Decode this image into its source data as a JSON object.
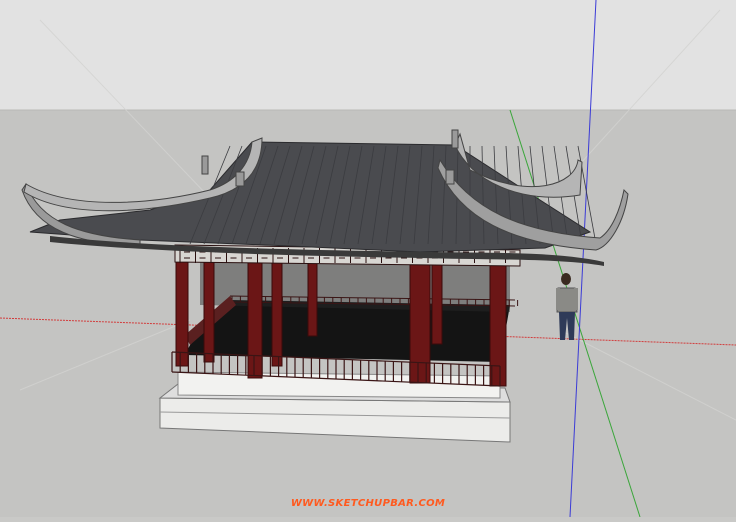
{
  "app": {
    "name": "SketchUp"
  },
  "scene": {
    "subject": "pavilion-model",
    "sky_color": "#e2e2e2",
    "ground_color": "#c4c4c2",
    "roof_color": "#4a4b4f",
    "column_color": "#6b1616",
    "base_color": "#ececea",
    "axis_colors": {
      "red": "#d23b3b",
      "green": "#3aa63a",
      "blue": "#3b3bd6"
    }
  },
  "watermark": {
    "text": "WWW.SKETCHUPBAR.COM"
  }
}
